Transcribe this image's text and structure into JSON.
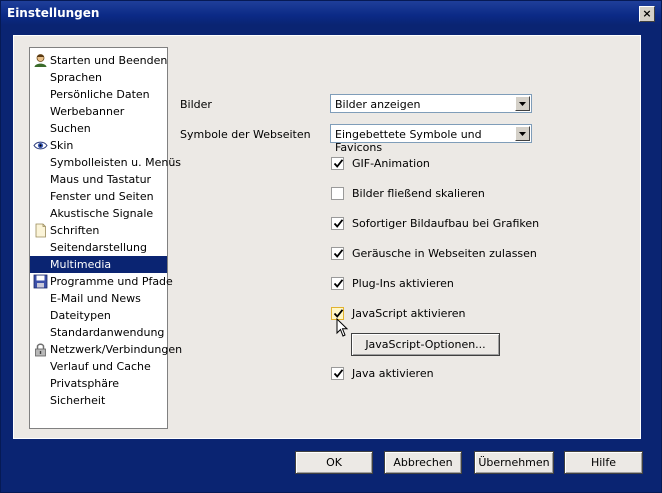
{
  "window": {
    "title": "Einstellungen",
    "close_glyph": "×"
  },
  "tree": {
    "items": [
      {
        "label": "Starten und Beenden",
        "icon": "person-icon"
      },
      {
        "label": "Sprachen"
      },
      {
        "label": "Persönliche Daten"
      },
      {
        "label": "Werbebanner"
      },
      {
        "label": "Suchen"
      },
      {
        "label": "Skin",
        "icon": "eye-icon"
      },
      {
        "label": "Symbolleisten u. Menüs"
      },
      {
        "label": "Maus und Tastatur"
      },
      {
        "label": "Fenster und Seiten"
      },
      {
        "label": "Akustische Signale"
      },
      {
        "label": "Schriften",
        "icon": "document-icon"
      },
      {
        "label": "Seitendarstellung"
      },
      {
        "label": "Multimedia",
        "selected": true
      },
      {
        "label": "Programme und Pfade",
        "icon": "floppy-disk-icon"
      },
      {
        "label": "E-Mail und News"
      },
      {
        "label": "Dateitypen"
      },
      {
        "label": "Standardanwendung"
      },
      {
        "label": "Netzwerk/Verbindungen",
        "icon": "lock-icon"
      },
      {
        "label": "Verlauf und Cache"
      },
      {
        "label": "Privatsphäre"
      },
      {
        "label": "Sicherheit"
      }
    ]
  },
  "settings": {
    "images": {
      "label": "Bilder",
      "value": "Bilder anzeigen"
    },
    "favicons": {
      "label": "Symbole der Webseiten",
      "value": "Eingebettete Symbole und Favicons"
    },
    "checkboxes": [
      {
        "label": "GIF-Animation",
        "checked": true
      },
      {
        "label": "Bilder fließend skalieren",
        "checked": false
      },
      {
        "label": "Sofortiger Bildaufbau bei Grafiken",
        "checked": true
      },
      {
        "label": "Geräusche in Webseiten zulassen",
        "checked": true
      },
      {
        "label": "Plug-Ins aktivieren",
        "checked": true
      },
      {
        "label": "JavaScript aktivieren",
        "checked": true,
        "hover": true
      },
      {
        "label": "Java aktivieren",
        "checked": true
      }
    ],
    "js_options_button": "JavaScript-Optionen..."
  },
  "footer": {
    "ok": "OK",
    "cancel": "Abbrechen",
    "apply": "Übernehmen",
    "help": "Hilfe"
  },
  "colors": {
    "titlebar": "#0a2472",
    "selection": "#0a2472",
    "panel": "#ece9e5"
  }
}
